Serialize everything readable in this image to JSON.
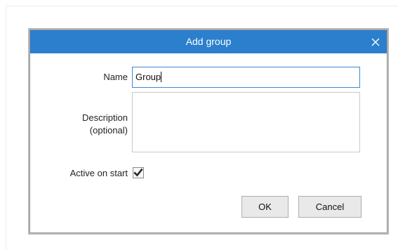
{
  "dialog": {
    "title": "Add group",
    "close_icon": "close-icon"
  },
  "form": {
    "name_label": "Name",
    "name_value": "Group",
    "description_label_line1": "Description",
    "description_label_line2": "(optional)",
    "description_value": "",
    "active_label": "Active on start",
    "active_checked": true,
    "checkmark_icon": "checkmark-icon"
  },
  "buttons": {
    "ok_label": "OK",
    "cancel_label": "Cancel"
  },
  "colors": {
    "titlebar": "#2b7fcc",
    "input_focus_border": "#3c87d6"
  }
}
